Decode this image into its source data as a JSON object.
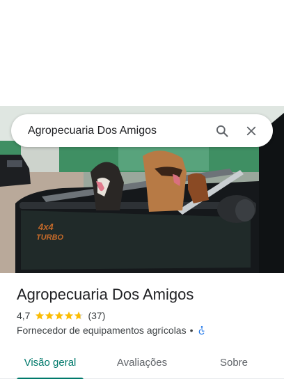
{
  "search": {
    "query": "Agropecuaria Dos Amigos",
    "search_icon": "search-icon",
    "close_icon": "close-icon"
  },
  "place": {
    "name": "Agropecuaria Dos Amigos",
    "rating": "4,7",
    "rating_value": 4.7,
    "review_count": "(37)",
    "category": "Fornecedor de equipamentos agrícolas",
    "separator": "•",
    "accessibility_icon": "wheelchair-icon"
  },
  "tabs": [
    {
      "label": "Visão geral",
      "active": true
    },
    {
      "label": "Avaliações",
      "active": false
    },
    {
      "label": "Sobre",
      "active": false
    }
  ],
  "colors": {
    "accent": "#00796b",
    "star": "#fbbc04",
    "accessibility": "#1a73e8"
  }
}
